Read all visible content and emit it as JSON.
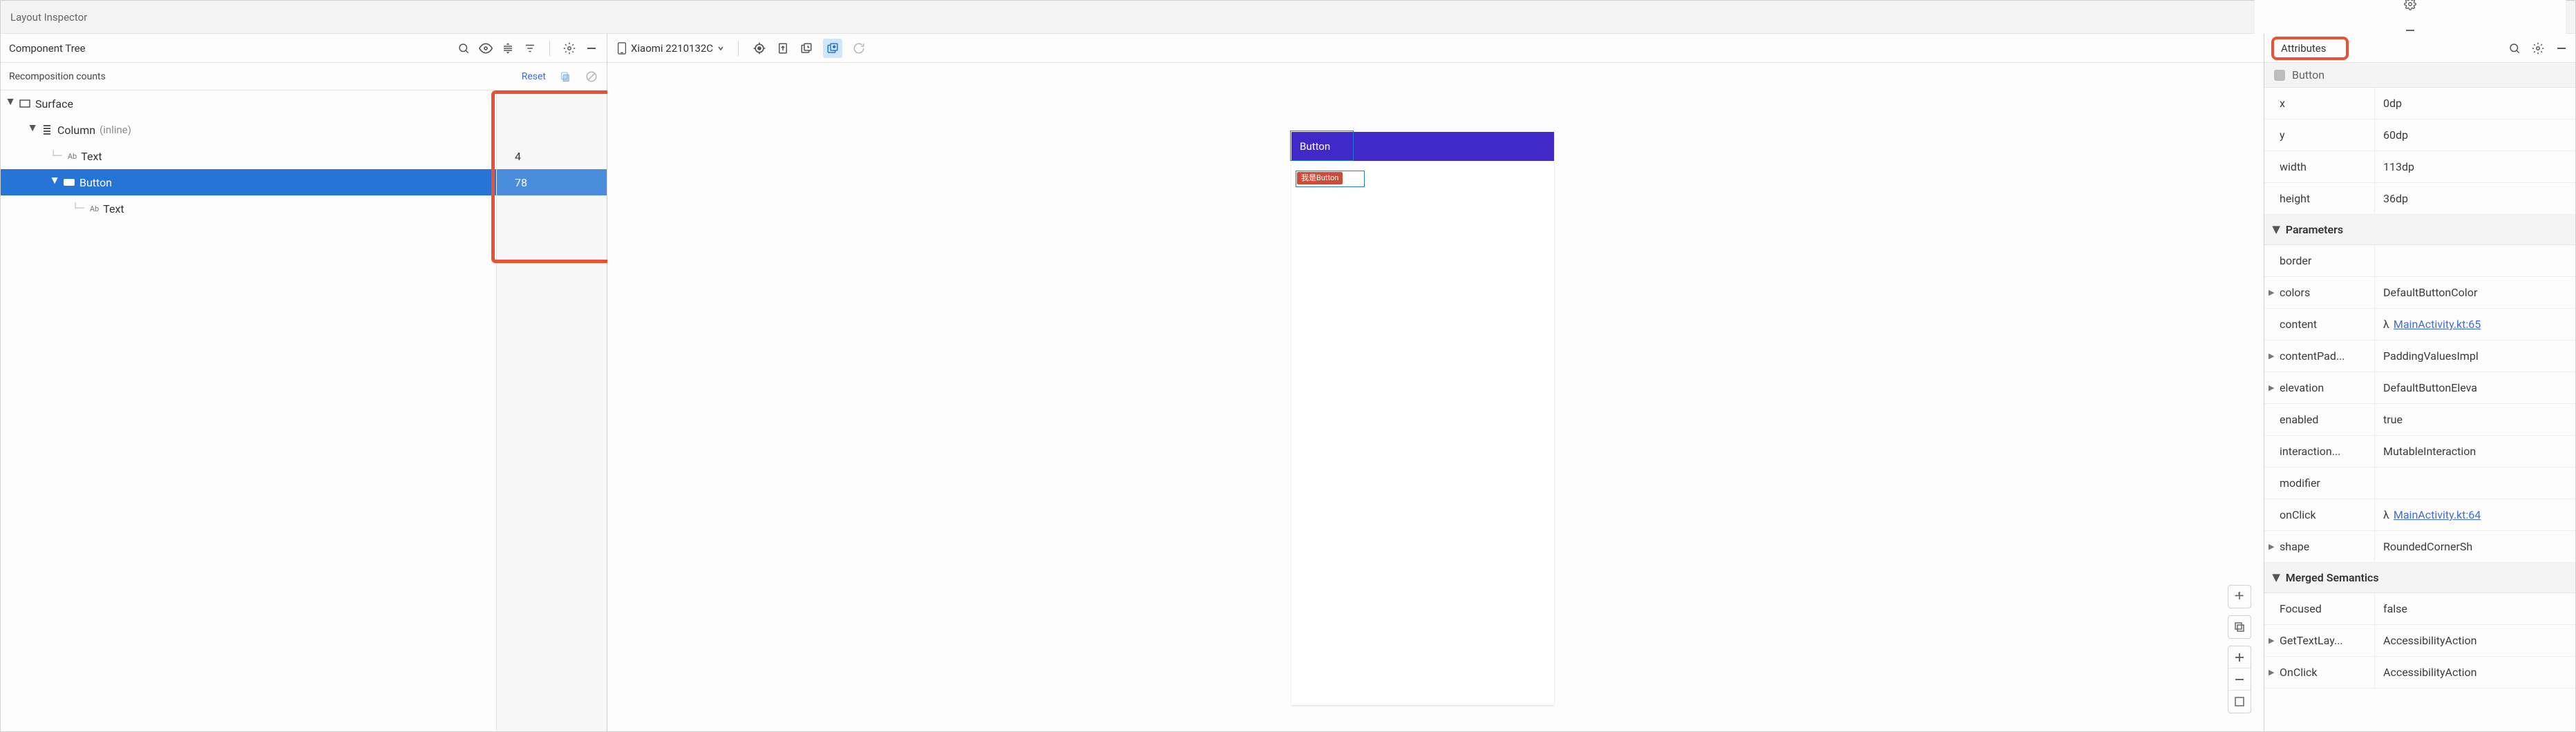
{
  "title": "Layout Inspector",
  "left": {
    "header_label": "Component Tree",
    "recomp_label": "Recomposition counts",
    "reset": "Reset",
    "tree": [
      {
        "id": "surface",
        "label": "Surface",
        "depth": 0,
        "expandable": true,
        "icon": "rect",
        "count": ""
      },
      {
        "id": "column",
        "label": "Column",
        "inline": "(inline)",
        "depth": 1,
        "expandable": true,
        "icon": "column",
        "count": ""
      },
      {
        "id": "text1",
        "label": "Text",
        "depth": 2,
        "expandable": false,
        "icon": "ab",
        "count": "4"
      },
      {
        "id": "button",
        "label": "Button",
        "depth": 2,
        "expandable": true,
        "icon": "fill",
        "count": "78",
        "selected": true
      },
      {
        "id": "text2",
        "label": "Text",
        "depth": 3,
        "expandable": false,
        "icon": "ab",
        "count": ""
      }
    ]
  },
  "center": {
    "device": "Xiaomi 2210132C",
    "phone_button": "Button",
    "chip": "我是Button"
  },
  "right": {
    "panel_title": "Attributes",
    "class": "Button",
    "basic": [
      {
        "k": "x",
        "v": "0dp"
      },
      {
        "k": "y",
        "v": "60dp"
      },
      {
        "k": "width",
        "v": "113dp"
      },
      {
        "k": "height",
        "v": "36dp"
      }
    ],
    "section_params": "Parameters",
    "params": [
      {
        "k": "border",
        "v": ""
      },
      {
        "k": "colors",
        "v": "DefaultButtonColor",
        "exp": true
      },
      {
        "k": "content",
        "v": "MainActivity.kt:65",
        "lambda": true
      },
      {
        "k": "contentPad...",
        "v": "PaddingValuesImpl",
        "exp": true
      },
      {
        "k": "elevation",
        "v": "DefaultButtonEleva",
        "exp": true
      },
      {
        "k": "enabled",
        "v": "true"
      },
      {
        "k": "interaction...",
        "v": "MutableInteraction"
      },
      {
        "k": "modifier",
        "v": ""
      },
      {
        "k": "onClick",
        "v": "MainActivity.kt:64",
        "lambda": true
      },
      {
        "k": "shape",
        "v": "RoundedCornerSh",
        "exp": true
      }
    ],
    "section_semantics": "Merged Semantics",
    "semantics": [
      {
        "k": "Focused",
        "v": "false"
      },
      {
        "k": "GetTextLay...",
        "v": "AccessibilityAction",
        "exp": true
      },
      {
        "k": "OnClick",
        "v": "AccessibilityAction",
        "exp": true
      }
    ]
  }
}
